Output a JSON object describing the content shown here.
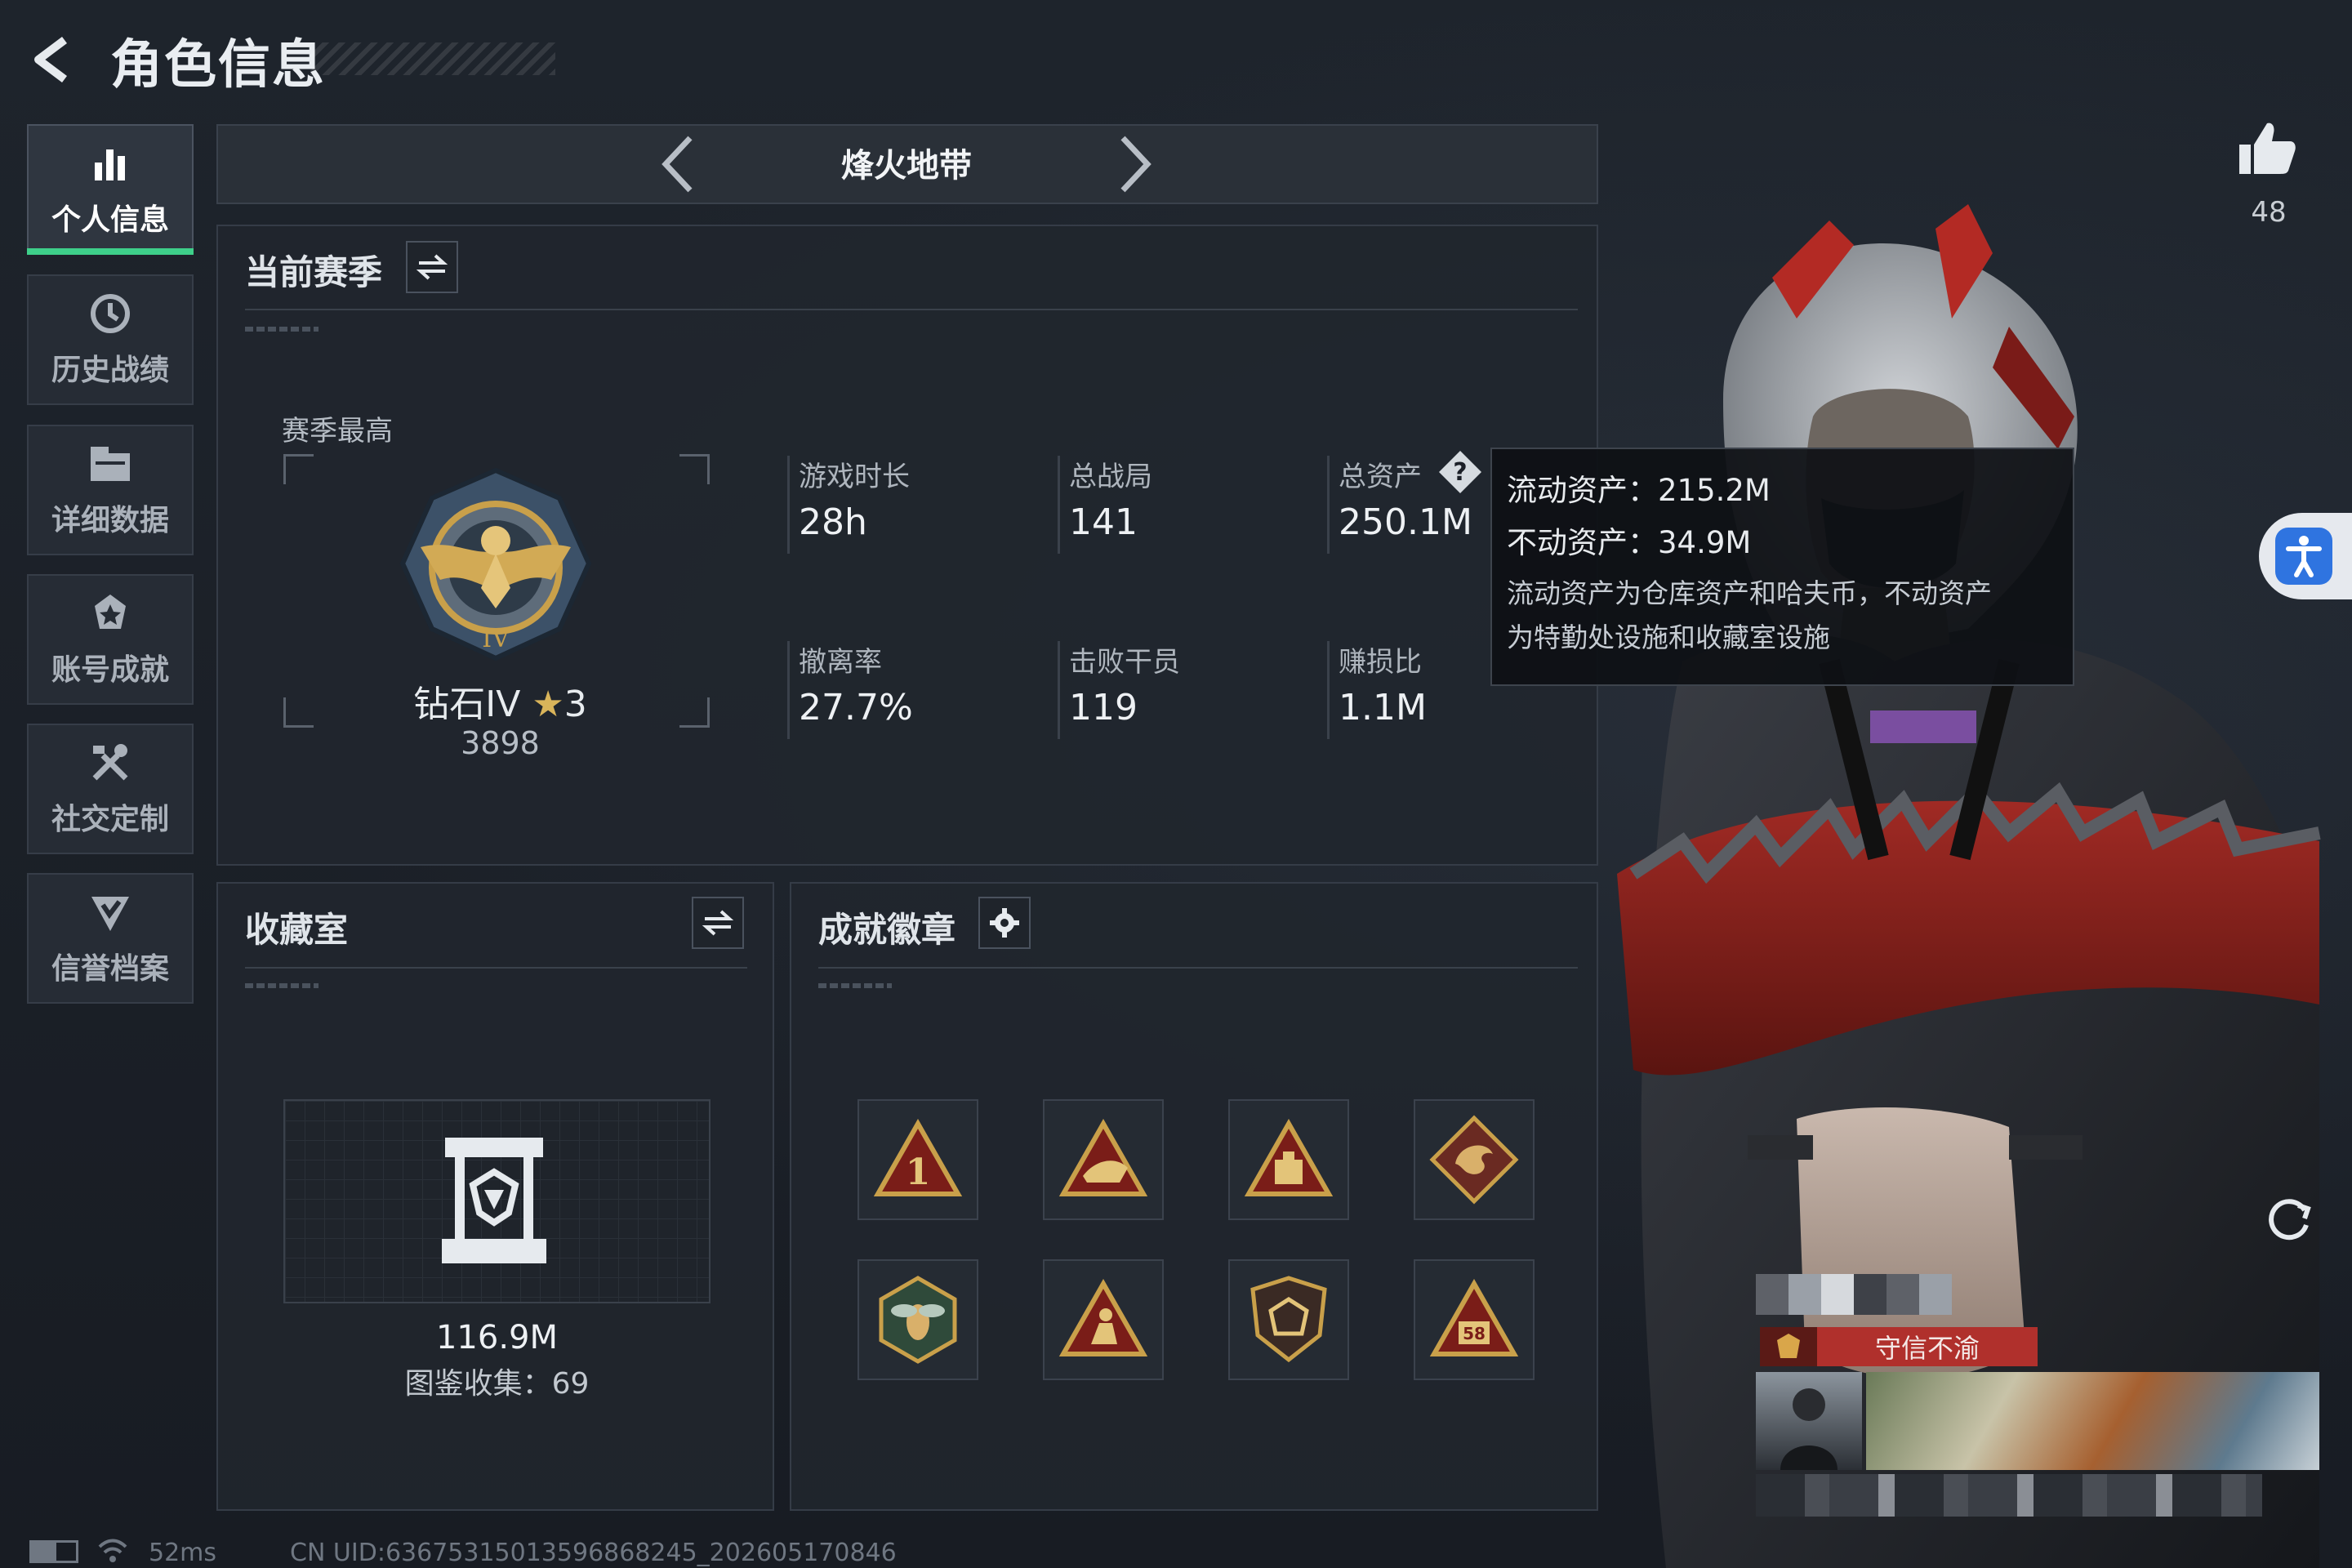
{
  "header": {
    "title": "角色信息"
  },
  "sidebar": {
    "items": [
      {
        "label": "个人信息",
        "icon": "bar-chart-icon",
        "active": true
      },
      {
        "label": "历史战绩",
        "icon": "history-clock-icon",
        "active": false
      },
      {
        "label": "详细数据",
        "icon": "folder-icon",
        "active": false
      },
      {
        "label": "账号成就",
        "icon": "achievement-icon",
        "active": false
      },
      {
        "label": "社交定制",
        "icon": "tools-icon",
        "active": false
      },
      {
        "label": "信誉档案",
        "icon": "shield-check-icon",
        "active": false
      }
    ]
  },
  "mode": {
    "title": "烽火地带"
  },
  "season": {
    "title": "当前赛季",
    "best_label": "赛季最高",
    "rank_name": "钻石IV",
    "rank_stars": "3",
    "rank_points": "3898",
    "stats": [
      {
        "label": "游戏时长",
        "value": "28h"
      },
      {
        "label": "总战局",
        "value": "141"
      },
      {
        "label": "总资产",
        "value": "250.1M"
      },
      {
        "label": "撤离率",
        "value": "27.7%"
      },
      {
        "label": "击败干员",
        "value": "119"
      },
      {
        "label": "赚损比",
        "value": "1.1M"
      }
    ]
  },
  "tooltip": {
    "liquid": "流动资产：215.2M",
    "fixed": "不动资产：34.9M",
    "note_1": "流动资产为仓库资产和哈夫币，不动资产",
    "note_2": "为特勤处设施和收藏室设施"
  },
  "collection": {
    "title": "收藏室",
    "value": "116.9M",
    "catalog": "图鉴收集：69"
  },
  "badges": {
    "title": "成就徽章",
    "items": [
      "rank-one-badge-icon",
      "sail-badge-icon",
      "bunker-badge-icon",
      "dragon-badge-icon",
      "bee-badge-icon",
      "climber-badge-icon",
      "dice-shield-badge-icon",
      "number-58-badge-icon"
    ]
  },
  "likes": {
    "count": "48"
  },
  "character": {
    "title_tag": "守信不渝"
  },
  "status": {
    "ping": "52ms",
    "uid": "CN UID:6367531501359686824​5_202605170846"
  },
  "colors": {
    "accent_green": "#3ed08a",
    "badge_gold": "#c9a04a",
    "badge_red": "#7a1d18",
    "tag_red": "#b0302c"
  }
}
